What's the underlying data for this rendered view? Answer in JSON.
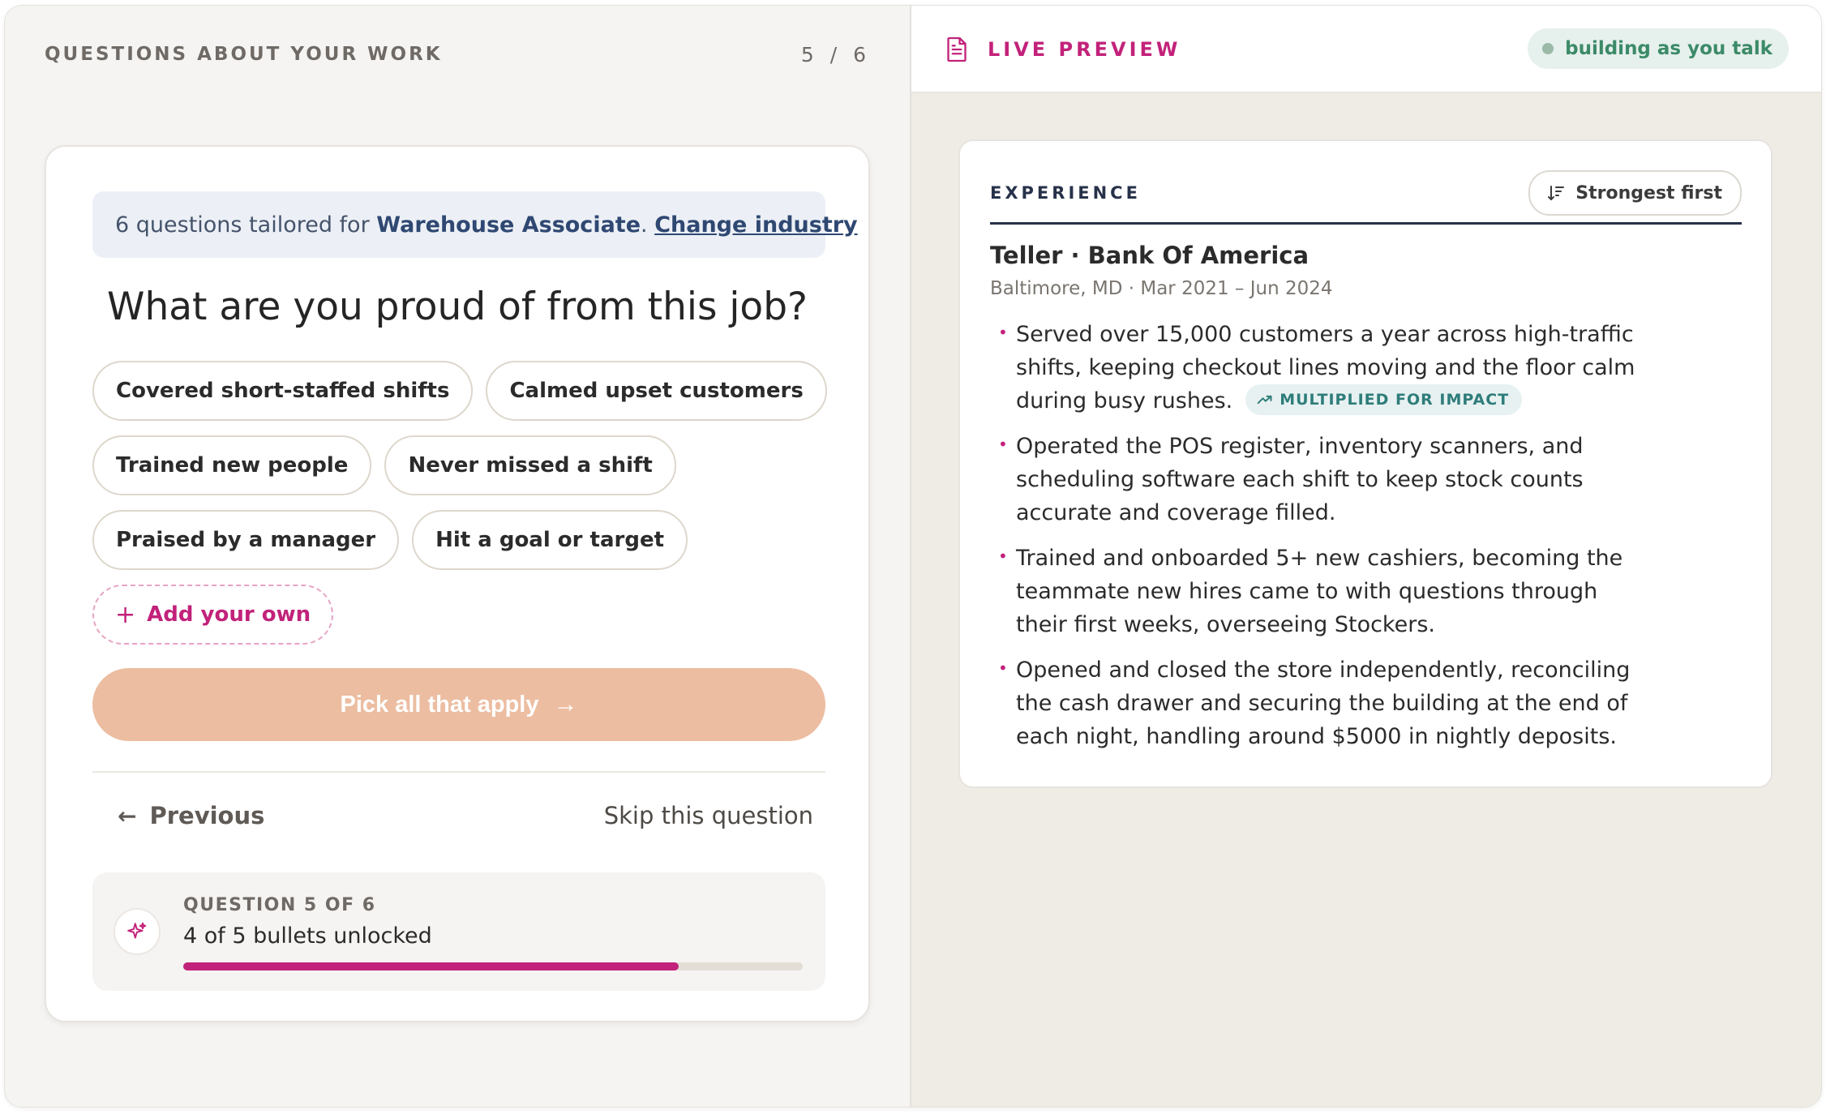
{
  "left": {
    "header_title": "QUESTIONS ABOUT YOUR WORK",
    "step_count": "5 / 6"
  },
  "card": {
    "notice_prefix": "6 questions tailored for ",
    "industry": "Warehouse Associate",
    "notice_sep": ".",
    "change_link": "Change industry",
    "question": "What are you proud of from this job?",
    "chips": [
      "Covered short-staffed shifts",
      "Calmed upset customers",
      "Trained new people",
      "Never missed a shift",
      "Praised by a manager",
      "Hit a goal or target"
    ],
    "add_own": "Add your own",
    "cta_label": "Pick all that apply",
    "prev_label": "Previous",
    "skip_label": "Skip this question",
    "progress": {
      "label": "QUESTION 5 OF 6",
      "status": "4 of 5 bullets unlocked",
      "fraction": 0.8
    }
  },
  "preview": {
    "header_title": "LIVE PREVIEW",
    "status_badge": "building as you talk",
    "section_title": "EXPERIENCE",
    "sort_label": "Strongest first",
    "job_title": "Teller · Bank Of America",
    "job_meta": "Baltimore, MD · Mar 2021 – Jun 2024",
    "bullets": [
      "Served over 15,000 customers a year across high-traffic shifts, keeping checkout lines moving and the floor calm during busy rushes.",
      "Operated the POS register, inventory scanners, and scheduling software each shift to keep stock counts accurate and coverage filled.",
      "Trained and onboarded 5+ new cashiers, becoming the teammate new hires came to with questions through their first weeks, overseeing Stockers.",
      "Opened and closed the store independently, reconciling the cash drawer and securing the building at the end of each night, handling around $5000 in nightly deposits."
    ],
    "impact_tag": "MULTIPLIED FOR IMPACT"
  },
  "colors": {
    "accent": "#c2227a",
    "cta": "#ecbda1",
    "navy": "#27324a",
    "success": "#3c8a68"
  }
}
